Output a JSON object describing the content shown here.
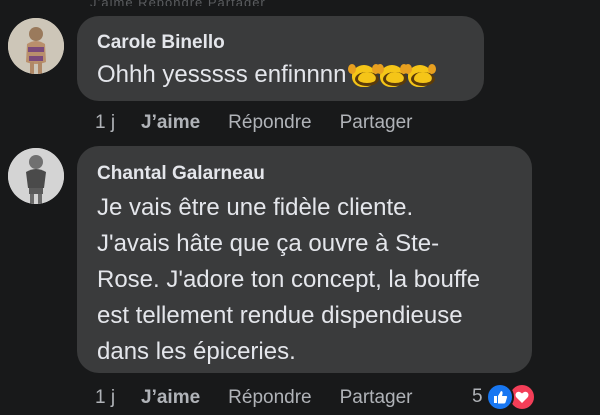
{
  "top_cutoff_text": "J’aime  Répondre  Partager",
  "comments": [
    {
      "author": "Carole Binello",
      "text": "Ohhh yesssss enfinnnn",
      "emojis": [
        "smiling-face-with-open-hands",
        "smiling-face-with-open-hands",
        "smiling-face-with-open-hands"
      ],
      "time": "1 j",
      "like_label": "J’aime",
      "reply_label": "Répondre",
      "share_label": "Partager"
    },
    {
      "author": "Chantal Galarneau",
      "text_lines": [
        "Je vais être une fidèle cliente.",
        "J'avais hâte que ça ouvre à Ste-",
        "Rose. J'adore ton concept, la bouffe",
        "est tellement rendue dispendieuse",
        "dans les épiceries."
      ],
      "time": "1 j",
      "like_label": "J’aime",
      "reply_label": "Répondre",
      "share_label": "Partager",
      "reaction_count": "5",
      "reaction_icons": [
        "like-icon",
        "love-icon"
      ]
    }
  ],
  "colors": {
    "background": "#18191a",
    "bubble": "#3a3b3c",
    "text": "#e4e6eb",
    "muted": "#b0b3b8",
    "like_blue": "#1877f2",
    "love_red": "#f33e58"
  }
}
